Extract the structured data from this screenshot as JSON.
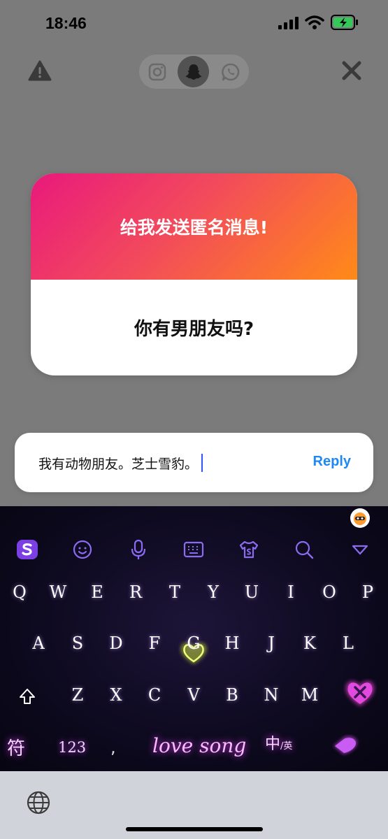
{
  "status_bar": {
    "time": "18:46"
  },
  "header": {
    "warning_icon": "warning-icon",
    "platforms": [
      "instagram-icon",
      "snapchat-icon",
      "whatsapp-icon"
    ],
    "selected_platform": "snapchat",
    "close_icon": "close-icon"
  },
  "card": {
    "title": "给我发送匿名消息!",
    "question": "你有男朋友吗?",
    "gradient": [
      "#e9197c",
      "#f24a5c",
      "#ff8a18"
    ]
  },
  "reply": {
    "text": "我有动物朋友。芝士雪豹。",
    "button_label": "Reply",
    "accent": "#1e88f5"
  },
  "keyboard": {
    "toolbar_icons": [
      "sogou-logo-icon",
      "emoji-icon",
      "microphone-icon",
      "keyboard-icon",
      "skin-icon",
      "search-icon",
      "collapse-icon"
    ],
    "rows": [
      [
        "Q",
        "W",
        "E",
        "R",
        "T",
        "Y",
        "U",
        "I",
        "O",
        "P"
      ],
      [
        "A",
        "S",
        "D",
        "F",
        "G",
        "H",
        "J",
        "K",
        "L"
      ],
      [
        "Z",
        "X",
        "C",
        "V",
        "B",
        "N",
        "M"
      ]
    ],
    "symbols_label": "符",
    "numbers_label": "123",
    "comma_label": ",",
    "space_label": "love song",
    "lang_main": "中",
    "lang_alt": "/英"
  },
  "bottom_bar": {
    "globe_icon": "globe-icon"
  }
}
